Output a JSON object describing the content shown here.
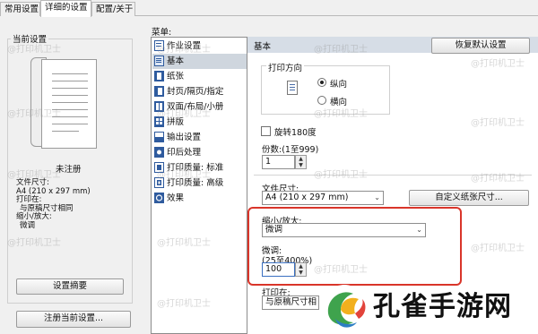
{
  "tabs": [
    "常用设置",
    "详细的设置",
    "配置/关于"
  ],
  "left": {
    "group_title": "当前设置",
    "status": "未注册",
    "info_lines": [
      "文件尺寸:",
      "A4 (210 x 297 mm)",
      "打印在:",
      "与原稿尺寸相同",
      "缩小/放大:",
      "微调"
    ],
    "summary_button": "设置摘要",
    "register_button": "注册当前设置..."
  },
  "menu": {
    "label": "菜单:",
    "items": [
      "作业设置",
      "基本",
      "纸张",
      "封页/隔页/指定",
      "双面/布局/小册",
      "拼版",
      "输出设置",
      "印后处理",
      "打印质量: 标准",
      "打印质量: 高级",
      "效果"
    ],
    "selected": "基本"
  },
  "pane": {
    "title": "基本",
    "restore_button": "恢复默认设置",
    "orientation": {
      "label": "打印方向",
      "portrait": "纵向",
      "landscape": "横向",
      "selected": "纵向"
    },
    "rotate_label": "旋转180度",
    "copies_label": "份数:(1至999)",
    "copies_value": "1",
    "paper_size_label": "文件尺寸:",
    "paper_size_value": "A4 (210 x 297 mm)",
    "custom_size_button": "自定义纸张尺寸...",
    "zoom_label": "缩小/放大:",
    "zoom_value": "微调",
    "fine_label": "微调:",
    "fine_range": "(25至400%)",
    "fine_value": "100",
    "print_on_label": "打印在:",
    "print_on_value": "与原稿尺寸相"
  },
  "watermark_text": "@打印机卫士",
  "logo_text": "孔雀手游网",
  "colors": {
    "highlight": "#d9352a",
    "selection": "#cfd6de",
    "pane_header": "#d6dde6"
  }
}
